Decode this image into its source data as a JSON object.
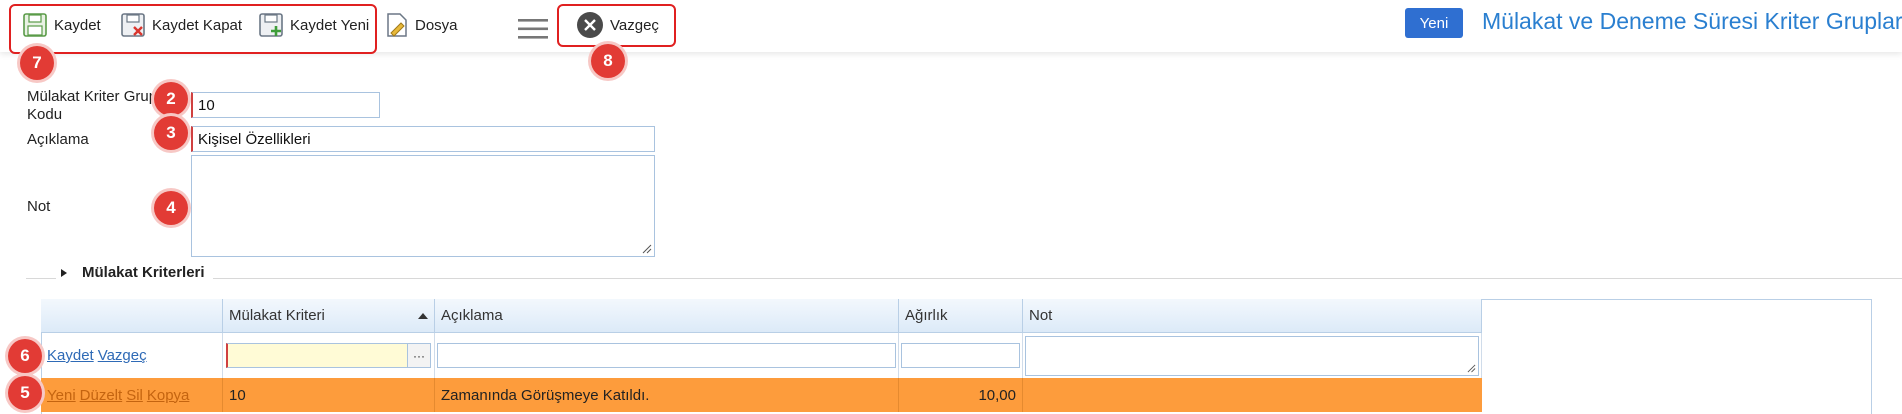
{
  "toolbar": {
    "save": "Kaydet",
    "save_close": "Kaydet Kapat",
    "save_new": "Kaydet Yeni",
    "file": "Dosya",
    "cancel": "Vazgeç"
  },
  "header": {
    "new_button": "Yeni",
    "title": "Mülakat ve Deneme Süresi Kriter Grupları"
  },
  "form": {
    "code_label_line1": "Mülakat Kriter Grup",
    "code_label_line2": "Kodu",
    "code_value": "10",
    "desc_label": "Açıklama",
    "desc_value": "Kişisel Özellikleri",
    "note_label": "Not",
    "note_value": ""
  },
  "section": {
    "title": "Mülakat Kriterleri"
  },
  "grid": {
    "columns": [
      "",
      "Mülakat Kriteri",
      "Açıklama",
      "Ağırlık",
      "Not"
    ],
    "edit_row": {
      "save": "Kaydet",
      "cancel": "Vazgeç",
      "ellipsis": "···"
    },
    "rows": [
      {
        "actions": [
          "Yeni",
          "Düzelt",
          "Sil",
          "Kopya"
        ],
        "criterion": "10",
        "description": "Zamanında Görüşmeye Katıldı.",
        "weight": "10,00",
        "note": ""
      }
    ]
  },
  "callouts": [
    "7",
    "2",
    "3",
    "4",
    "6",
    "5",
    "8"
  ],
  "colors": {
    "accent_blue": "#2a7fd0",
    "new_button": "#2f6fd1",
    "row_highlight": "#fd9c3c",
    "callout_red": "#e23b35"
  }
}
